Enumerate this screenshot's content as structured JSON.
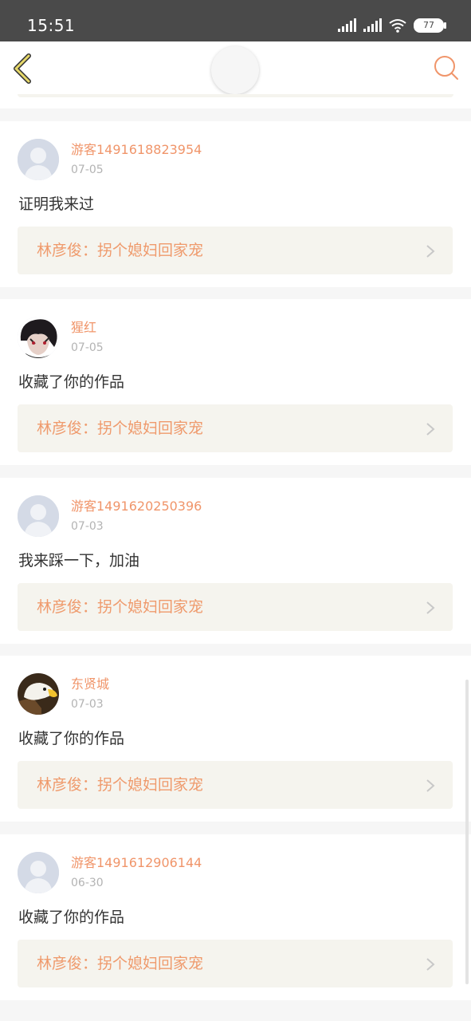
{
  "status_bar": {
    "time": "15:51",
    "battery": "77"
  },
  "header": {
    "back_icon": "back-chevron-icon",
    "search_icon": "search-icon"
  },
  "comments": [
    {
      "username": "游客1491618823954",
      "date": "07-05",
      "text": "证明我来过",
      "quote": "林彦俊：拐个媳妇回家宠",
      "avatar": "default-avatar"
    },
    {
      "username": "猩红",
      "date": "07-05",
      "text": "收藏了你的作品",
      "quote": "林彦俊：拐个媳妇回家宠",
      "avatar": "anime-avatar"
    },
    {
      "username": "游客1491620250396",
      "date": "07-03",
      "text": "我来踩一下，加油",
      "quote": "林彦俊：拐个媳妇回家宠",
      "avatar": "default-avatar"
    },
    {
      "username": "东贤城",
      "date": "07-03",
      "text": "收藏了你的作品",
      "quote": "林彦俊：拐个媳妇回家宠",
      "avatar": "eagle-avatar"
    },
    {
      "username": "游客1491612906144",
      "date": "06-30",
      "text": "收藏了你的作品",
      "quote": "林彦俊：拐个媳妇回家宠",
      "avatar": "default-avatar"
    }
  ],
  "colors": {
    "accent": "#f0956a",
    "quote_bg": "#f5f4ee",
    "status_bg": "#4a4a4a"
  }
}
